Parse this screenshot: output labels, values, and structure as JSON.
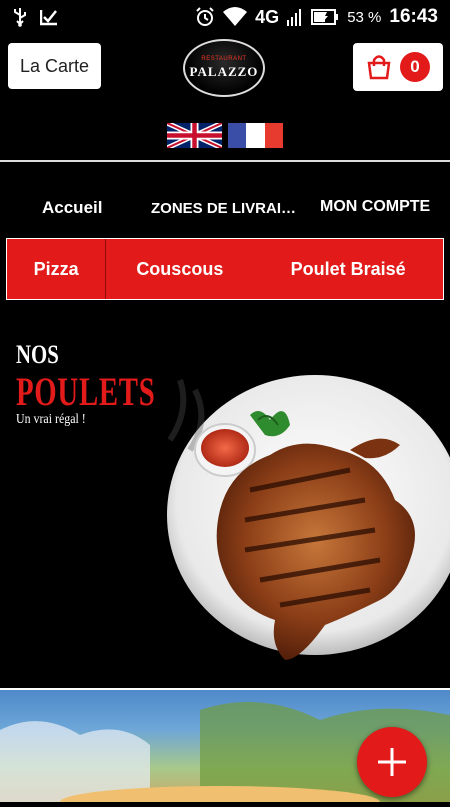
{
  "status_bar": {
    "network": "4G",
    "battery_percent": "53 %",
    "time": "16:43"
  },
  "header": {
    "menu_button_label": "La Carte",
    "logo_top_text": "RESTAURANT",
    "logo_name": "PALAZZO",
    "cart_count": "0"
  },
  "languages": [
    {
      "name": "english-flag"
    },
    {
      "name": "french-flag"
    }
  ],
  "nav": {
    "items": [
      {
        "label": "Accueil"
      },
      {
        "label": "ZONES DE LIVRAISON"
      },
      {
        "label": "MON COMPTE"
      }
    ]
  },
  "categories": [
    {
      "label": "Pizza"
    },
    {
      "label": "Couscous"
    },
    {
      "label": "Poulet Braisé"
    }
  ],
  "promo": {
    "line1": "NOS",
    "line2": "POULETS",
    "line3": "Un vrai régal !"
  },
  "colors": {
    "accent": "#e21a1a",
    "background": "#000000"
  }
}
